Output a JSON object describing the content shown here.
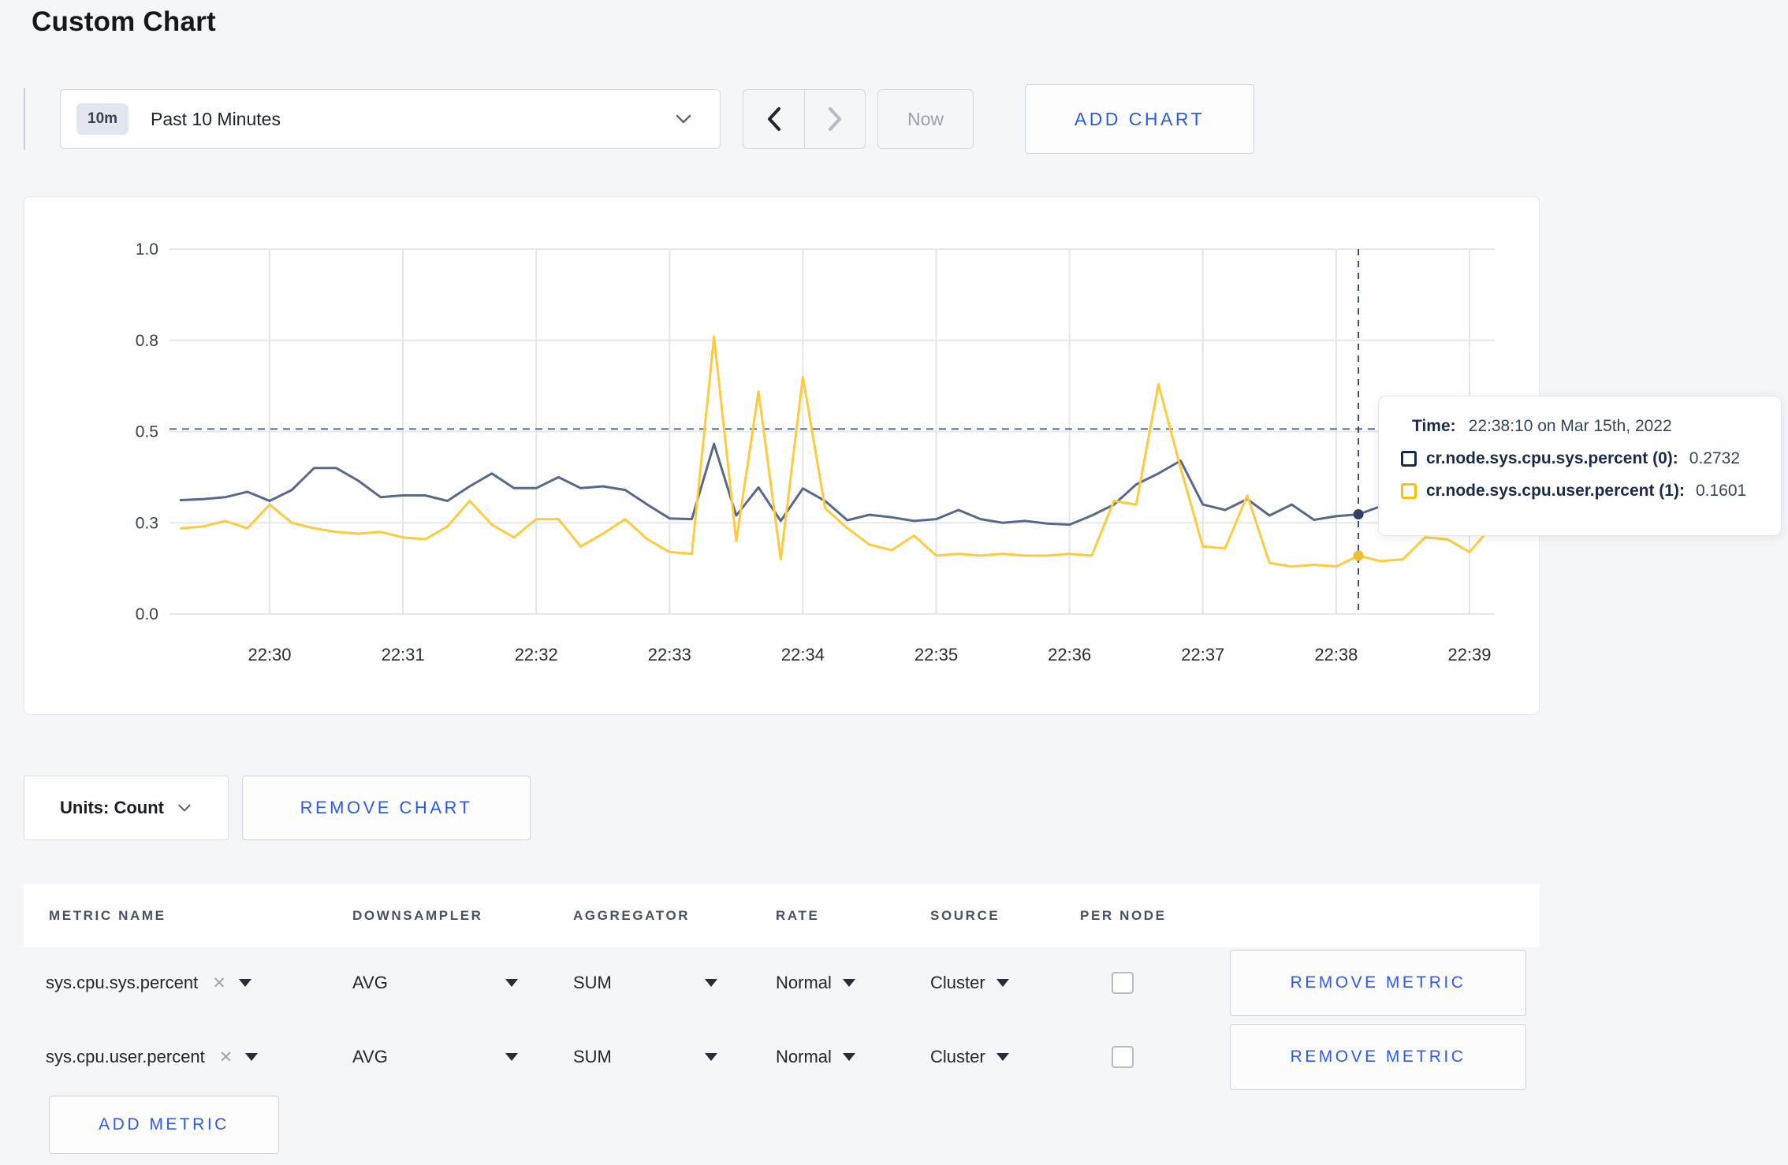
{
  "page": {
    "title": "Custom Chart",
    "background": "#f5f6fa",
    "accent_blue": "#2a5af5"
  },
  "toolbar": {
    "time_window_badge": "10m",
    "time_window_label": "Past 10 Minutes",
    "prev_icon": "chevron-left",
    "next_icon": "chevron-right",
    "now_label": "Now",
    "add_chart_label": "ADD CHART"
  },
  "tooltip": {
    "time_label": "Time:",
    "time_value": "22:38:10 on Mar 15th, 2022",
    "series": [
      {
        "label": "cr.node.sys.cpu.sys.percent (0):",
        "value": "0.2732",
        "color": "#17294d"
      },
      {
        "label": "cr.node.sys.cpu.user.percent (1):",
        "value": "0.1601",
        "color": "#fdc008"
      }
    ]
  },
  "units_bar": {
    "units_label": "Units: Count",
    "remove_chart_label": "REMOVE CHART"
  },
  "metrics_table": {
    "columns": [
      "METRIC NAME",
      "DOWNSAMPLER",
      "AGGREGATOR",
      "RATE",
      "SOURCE",
      "PER NODE"
    ],
    "rows": [
      {
        "metric_name": "sys.cpu.sys.percent",
        "downsampler": "AVG",
        "aggregator": "SUM",
        "rate": "Normal",
        "source": "Cluster",
        "per_node_checked": false,
        "remove_label": "REMOVE METRIC"
      },
      {
        "metric_name": "sys.cpu.user.percent",
        "downsampler": "AVG",
        "aggregator": "SUM",
        "rate": "Normal",
        "source": "Cluster",
        "per_node_checked": false,
        "remove_label": "REMOVE METRIC"
      }
    ],
    "add_metric_label": "ADD METRIC"
  },
  "chart_data": {
    "type": "line",
    "title": "",
    "xlabel": "",
    "ylabel": "",
    "ylim": [
      0,
      1
    ],
    "grid": true,
    "legend_position": "none",
    "x_start": "22:29:20",
    "interval_seconds": 10,
    "x_ticks": [
      {
        "sec": 40,
        "label": "22:30"
      },
      {
        "sec": 100,
        "label": "22:31"
      },
      {
        "sec": 160,
        "label": "22:32"
      },
      {
        "sec": 220,
        "label": "22:33"
      },
      {
        "sec": 280,
        "label": "22:34"
      },
      {
        "sec": 340,
        "label": "22:35"
      },
      {
        "sec": 400,
        "label": "22:36"
      },
      {
        "sec": 460,
        "label": "22:37"
      },
      {
        "sec": 520,
        "label": "22:38"
      },
      {
        "sec": 580,
        "label": "22:39"
      }
    ],
    "y_ticks": [
      {
        "v": 0,
        "label": "0.0"
      },
      {
        "v": 0.25,
        "label": "0.3"
      },
      {
        "v": 0.5,
        "label": "0.5"
      },
      {
        "v": 0.75,
        "label": "0.8"
      },
      {
        "v": 1.0,
        "label": "1.0"
      }
    ],
    "series": [
      {
        "name": "cr.node.sys.cpu.sys.percent",
        "color": "#56688c",
        "dot_color": "#2f4165",
        "values": [
          0.312,
          0.315,
          0.32,
          0.335,
          0.31,
          0.34,
          0.4,
          0.4,
          0.365,
          0.32,
          0.325,
          0.325,
          0.31,
          0.35,
          0.385,
          0.345,
          0.345,
          0.375,
          0.345,
          0.35,
          0.34,
          0.3,
          0.262,
          0.26,
          0.466,
          0.27,
          0.347,
          0.255,
          0.344,
          0.31,
          0.257,
          0.272,
          0.265,
          0.255,
          0.26,
          0.285,
          0.26,
          0.25,
          0.255,
          0.248,
          0.245,
          0.27,
          0.3,
          0.355,
          0.385,
          0.42,
          0.3,
          0.285,
          0.315,
          0.27,
          0.3,
          0.258,
          0.268,
          0.2732,
          0.295,
          0.285,
          0.29,
          0.3,
          0.285,
          0.295
        ]
      },
      {
        "name": "cr.node.sys.cpu.user.percent",
        "color": "#ffcb3d",
        "dot_color": "#f0bd2e",
        "values": [
          0.235,
          0.24,
          0.255,
          0.235,
          0.3,
          0.25,
          0.235,
          0.225,
          0.22,
          0.225,
          0.21,
          0.205,
          0.24,
          0.31,
          0.245,
          0.21,
          0.26,
          0.26,
          0.185,
          0.22,
          0.26,
          0.205,
          0.17,
          0.165,
          0.76,
          0.2,
          0.61,
          0.15,
          0.65,
          0.29,
          0.235,
          0.19,
          0.175,
          0.215,
          0.16,
          0.165,
          0.16,
          0.165,
          0.16,
          0.16,
          0.165,
          0.16,
          0.31,
          0.3,
          0.63,
          0.4,
          0.185,
          0.18,
          0.325,
          0.14,
          0.13,
          0.135,
          0.13,
          0.1601,
          0.145,
          0.15,
          0.21,
          0.205,
          0.17,
          0.24
        ]
      }
    ],
    "crosshair": {
      "index": 53,
      "time": "22:38:10",
      "h_value": 0.507
    }
  }
}
